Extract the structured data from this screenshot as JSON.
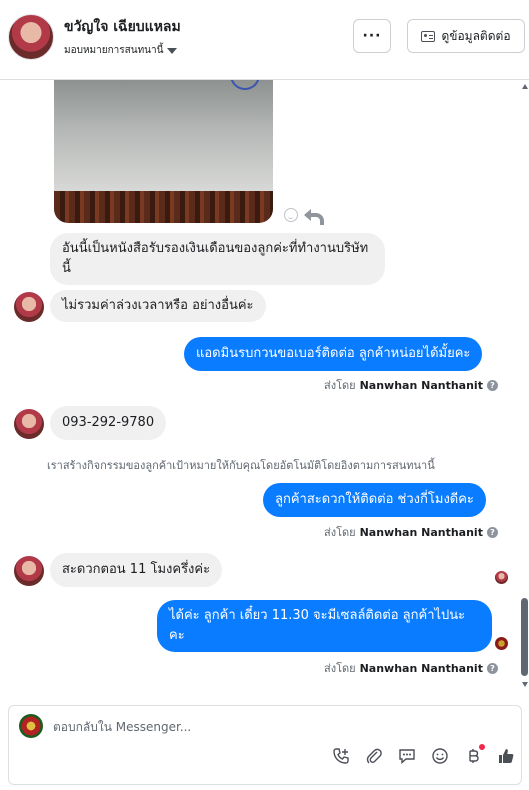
{
  "header": {
    "contact_name": "ขวัญใจ เฉียบแหลม",
    "assign_label": "มอบหมายการสนทนานี้",
    "more_label": "···",
    "contact_info_label": "ดูข้อมูลติดต่อ"
  },
  "thread": {
    "messages": [
      {
        "from": "customer",
        "text": "อันนี้เป็นหนังสือรับรองเงินเดือนของลูกค่ะที่ทำงานบริษัทนี้"
      },
      {
        "from": "customer",
        "text": "ไม่รวมค่าล่วงเวลาหรือ อย่างอื่นค่ะ"
      },
      {
        "from": "page",
        "text": "แอดมินรบกวนขอเบอร์ติดต่อ ลูกค้าหน่อยได้มั้ยคะ",
        "sent_by_prefix": "ส่งโดย",
        "sent_by_name": "Nanwhan Nanthanit"
      },
      {
        "from": "customer",
        "text": "093-292-9780"
      },
      {
        "from": "system",
        "text": "เราสร้างกิจกรรมของลูกค้าเป้าหมายให้กับคุณโดยอัตโนมัติโดยอิงตามการสนทนานี้"
      },
      {
        "from": "page",
        "text": "ลูกค้าสะดวกให้ติดต่อ ช่วงกี่โมงดีคะ",
        "sent_by_prefix": "ส่งโดย",
        "sent_by_name": "Nanwhan Nanthanit"
      },
      {
        "from": "customer",
        "text": "สะดวกตอน 11 โมงครึ่งค่ะ"
      },
      {
        "from": "page",
        "text": "ได้ค่ะ ลูกค้า เดี๋ยว 11.30 จะมีเซลล์ติดต่อ ลูกค้าไปนะคะ",
        "sent_by_prefix": "ส่งโดย",
        "sent_by_name": "Nanwhan Nanthanit"
      }
    ],
    "help_glyph": "?"
  },
  "composer": {
    "placeholder": "ตอบกลับใน Messenger...",
    "tools": [
      "phone-add-icon",
      "attachment-icon",
      "saved-reply-icon",
      "emoji-icon",
      "payment-icon",
      "like-icon"
    ]
  },
  "colors": {
    "outgoing_bubble": "#0a7cff",
    "incoming_bubble": "#f0f0f0",
    "badge_red": "#f02849"
  }
}
